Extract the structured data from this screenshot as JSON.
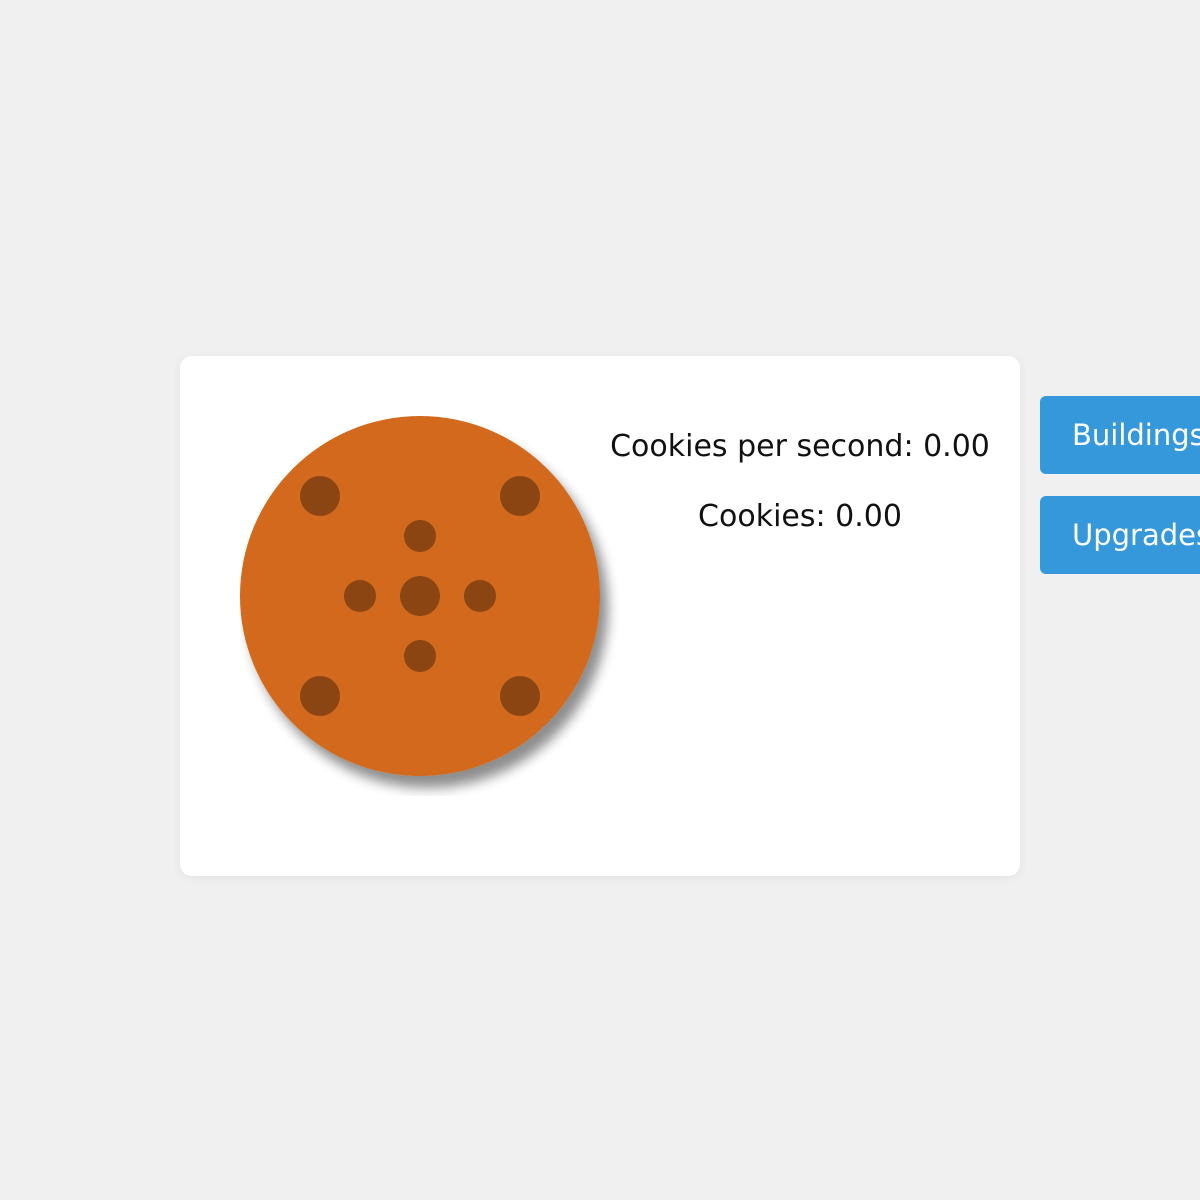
{
  "stats": {
    "cookies_per_second_label": "Cookies per second: 0.00",
    "cookies_label": "Cookies: 0.00"
  },
  "side_menu": {
    "buildings_label": "Buildings",
    "upgrades_label": "Upgrades"
  },
  "colors": {
    "page_background": "#f0f0f0",
    "card_background": "#ffffff",
    "cookie_dough": "#d2691a",
    "chocolate_chip": "#8b4513",
    "button_blue": "#3598db"
  },
  "icons": {
    "cookie": "cookie-icon"
  }
}
